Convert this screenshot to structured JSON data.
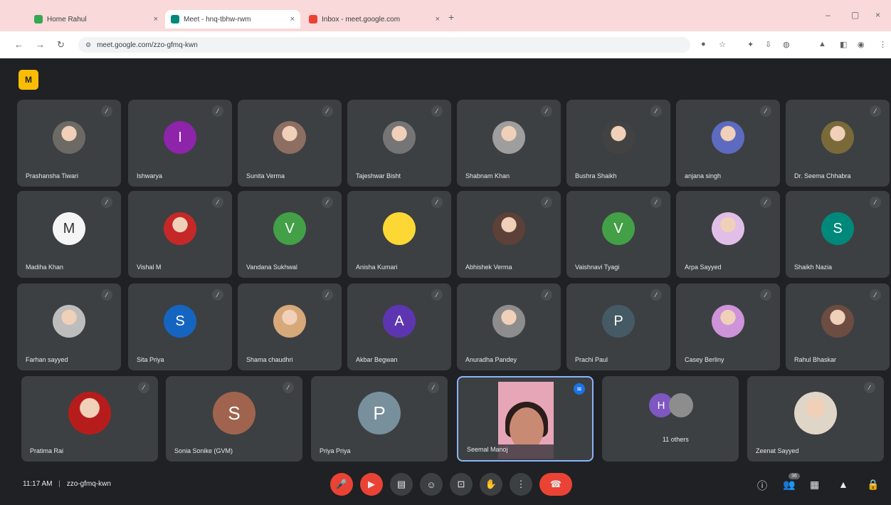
{
  "browser": {
    "tabs": [
      {
        "label": "Home Rahul",
        "active": false,
        "favicon_color": "#34a853"
      },
      {
        "label": "Meet - hnq-tbhw-rwm",
        "active": true,
        "favicon_color": "#00897b"
      },
      {
        "label": "Inbox - meet.google.com",
        "active": false,
        "favicon_color": "#ea4335"
      }
    ],
    "new_tab": "+",
    "url": "meet.google.com/zzo-gfmq-kwn"
  },
  "meet": {
    "logo_label": "M",
    "participants_rows": [
      [
        {
          "name": "Prashansha Tiwari",
          "avatar": "photo",
          "color": "#6d6a66"
        },
        {
          "name": "Ishwarya",
          "avatar": "letter",
          "letter": "I",
          "color": "#8e24aa"
        },
        {
          "name": "Sunita Verma",
          "avatar": "photo",
          "color": "#8d6e63"
        },
        {
          "name": "Tajeshwar Bisht",
          "avatar": "photo",
          "color": "#757575"
        },
        {
          "name": "Shabnam Khan",
          "avatar": "photo",
          "color": "#9e9e9e"
        },
        {
          "name": "Bushra Shaikh",
          "avatar": "photo",
          "color": "#424242"
        },
        {
          "name": "anjana singh",
          "avatar": "photo",
          "color": "#5c6bc0"
        },
        {
          "name": "Dr. Seema Chhabra",
          "avatar": "photo",
          "color": "#7a6a3a"
        }
      ],
      [
        {
          "name": "Madiha Khan",
          "avatar": "letter",
          "letter": "M",
          "color": "#f5f5f5",
          "text_color": "#333333"
        },
        {
          "name": "Vishal M",
          "avatar": "photo",
          "color": "#c62828"
        },
        {
          "name": "Vandana Sukhwal",
          "avatar": "letter",
          "letter": "V",
          "color": "#43a047"
        },
        {
          "name": "Anisha Kumari",
          "avatar": "letter",
          "letter": "",
          "color": "#fdd835"
        },
        {
          "name": "Abhishek Verma",
          "avatar": "photo",
          "color": "#5d4037"
        },
        {
          "name": "Vaishnavi Tyagi",
          "avatar": "letter",
          "letter": "V",
          "color": "#43a047"
        },
        {
          "name": "Arpa Sayyed",
          "avatar": "photo",
          "color": "#e1bee7"
        },
        {
          "name": "Shaikh Nazia",
          "avatar": "letter",
          "letter": "S",
          "color": "#00897b"
        }
      ],
      [
        {
          "name": "Farhan sayyed",
          "avatar": "photo",
          "color": "#bdbdbd"
        },
        {
          "name": "Sita Priya",
          "avatar": "letter",
          "letter": "S",
          "color": "#1565c0"
        },
        {
          "name": "Shama chaudhri",
          "avatar": "photo",
          "color": "#d7a87a"
        },
        {
          "name": "Akbar Begwan",
          "avatar": "letter",
          "letter": "A",
          "color": "#5e35b1"
        },
        {
          "name": "Anuradha Pandey",
          "avatar": "photo",
          "color": "#8d8d8d"
        },
        {
          "name": "Prachi Paul",
          "avatar": "letter",
          "letter": "P",
          "color": "#455a64"
        },
        {
          "name": "Casey Berliny",
          "avatar": "photo",
          "color": "#ce93d8"
        },
        {
          "name": "Rahul Bhaskar",
          "avatar": "photo",
          "color": "#6d4c41"
        }
      ]
    ],
    "bottom_row": [
      {
        "name": "Pratima Rai",
        "avatar": "photo",
        "color": "#b71c1c"
      },
      {
        "name": "Sonia Sonike (GVM)",
        "avatar": "letter",
        "letter": "S",
        "color": "#a0644e"
      },
      {
        "name": "Priya Priya",
        "avatar": "letter",
        "letter": "P",
        "color": "#78909c"
      },
      {
        "name": "Seemal Manoj",
        "avatar": "video",
        "color": "#e7a6b8"
      },
      {
        "name": "11 others",
        "avatar": "group",
        "letter": "H",
        "color": "#7e57c2"
      },
      {
        "name": "Zeenat Sayyed",
        "avatar": "photo",
        "color": "#e0d6c8"
      }
    ],
    "icons": {
      "mute": "mic-off-icon",
      "speaking": "audio-wave-icon"
    }
  },
  "bottombar": {
    "time": "11:17 AM",
    "separator": "|",
    "meeting_code": "zzo-gfmq-kwn",
    "controls": [
      {
        "name": "mic-off-icon",
        "glyph": "🎤",
        "style": "red"
      },
      {
        "name": "camera-off-icon",
        "glyph": "▶",
        "style": "red"
      },
      {
        "name": "captions-icon",
        "glyph": "▤",
        "style": "normal"
      },
      {
        "name": "emoji-icon",
        "glyph": "☺",
        "style": "normal"
      },
      {
        "name": "present-icon",
        "glyph": "⊡",
        "style": "normal"
      },
      {
        "name": "raise-hand-icon",
        "glyph": "✋",
        "style": "normal"
      },
      {
        "name": "more-options-icon",
        "glyph": "⋮",
        "style": "normal"
      },
      {
        "name": "hang-up-icon",
        "glyph": "☎",
        "style": "hangup"
      }
    ],
    "right_icons": [
      {
        "name": "info-icon",
        "glyph": "ⓘ"
      },
      {
        "name": "people-icon",
        "glyph": "👥",
        "badge": "36"
      },
      {
        "name": "chat-icon",
        "glyph": "▦"
      },
      {
        "name": "activities-icon",
        "glyph": "▲"
      },
      {
        "name": "host-controls-icon",
        "glyph": "🔒"
      }
    ]
  }
}
